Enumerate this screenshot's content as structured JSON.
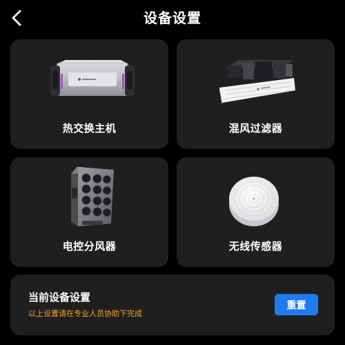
{
  "header": {
    "title": "设备设置",
    "back_icon": "chevron-left-icon"
  },
  "devices": [
    {
      "label": "热交换主机",
      "icon": "heat-exchanger-image"
    },
    {
      "label": "混风过滤器",
      "icon": "mixing-filter-image"
    },
    {
      "label": "电控分风器",
      "icon": "air-distributor-image"
    },
    {
      "label": "无线传感器",
      "icon": "wireless-sensor-image"
    }
  ],
  "settings": {
    "title": "当前设备设置",
    "subtitle": "以上设置请在专业人员协助下完成",
    "reset_label": "重置"
  },
  "colors": {
    "background": "#000000",
    "card": "#1f1f1f",
    "accent": "#1e7bf0",
    "warning_text": "#f5a623"
  }
}
